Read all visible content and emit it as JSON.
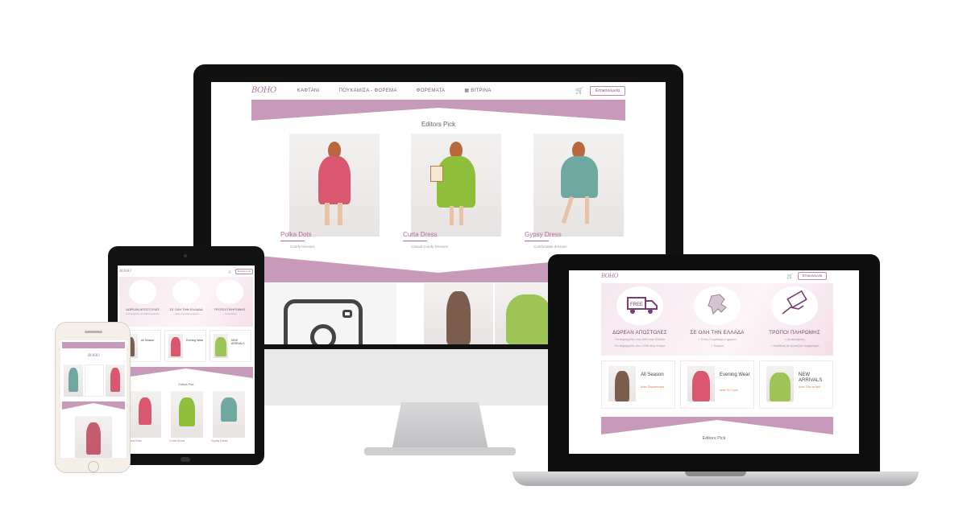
{
  "desktop": {
    "logo": "BOHO",
    "nav": [
      "ΚΑΦΤΑΝΙ",
      "ΠΟΥΚΑΜΙΣΑ - ΦΟΡΕΜΑ",
      "ΦΟΡΕΜΑΤΑ",
      "ΒΙΤΡΙΝΑ"
    ],
    "login_button": "Επικοινωνία",
    "section_title": "Editors Pick",
    "products": [
      {
        "name": "Polka Dots",
        "desc": "Comfy Dresses"
      },
      {
        "name": "Curta Dress",
        "desc": "Casual Comfy Dresses"
      },
      {
        "name": "Gypsy Dress",
        "desc": "Comfortable dresses"
      }
    ]
  },
  "laptop": {
    "logo": "BOHO",
    "login_button": "Επικοινωνία",
    "features": [
      {
        "title": "ΔΩΡΕΑΝ ΑΠΟΣΤΟΛΕΣ",
        "sub1": "Για παραγγελίες άνω 50€ στην Ελλάδα",
        "sub2": "Για παραγγελίες άνω 100€ στην Κύπρο"
      },
      {
        "title": "ΣΕ ΟΛΗ ΤΗΝ ΕΛΛΑΔΑ",
        "sub1": "✓ Εντός 3 εργάσιμων ημερών",
        "sub2": "✓ Κύπρος"
      },
      {
        "title": "ΤΡΟΠΟΙ ΠΛΗΡΩΜΗΣ",
        "sub1": "✓ Αντικαταβολή",
        "sub2": "✓ Κατάθεση σε τραπεζικό λογαριασμό"
      }
    ],
    "categories": [
      {
        "title": "All Season",
        "link": "Δείτε Περισσότερα"
      },
      {
        "title": "Evening Wear",
        "link": "Δείτε Τα Τώρα"
      },
      {
        "title": "NEW ARRIVALS",
        "link": "Δείτε Όλα τα Νέα"
      }
    ],
    "section_title": "Editors Pick"
  },
  "tablet": {
    "logo": "BOHO",
    "login_button": "Επικοινωνία",
    "features": [
      {
        "title": "ΔΩΡΕΑΝ ΑΠΟΣΤΟΛΕΣ",
        "sub": "Για παραγγελίες άνω 50€ στην Ελλάδα"
      },
      {
        "title": "ΣΕ ΟΛΗ ΤΗΝ ΕΛΛΑΔΑ",
        "sub": "✓ Εντός 3 εργάσιμων ημερών"
      },
      {
        "title": "ΤΡΟΠΟΙ ΠΛΗΡΩΜΗΣ",
        "sub": "✓ Αντικαταβολή"
      }
    ],
    "categories": [
      "All Season",
      "Evening Wear",
      "NEW ARRIVALS"
    ],
    "section_title": "Editors Pick",
    "products": [
      "Polka Dots",
      "Curta Dress",
      "Gypsy Dress"
    ]
  },
  "phone": {
    "logo": "BOHO"
  },
  "colors": {
    "accent": "#c79ab9",
    "accent_dark": "#b46aa0",
    "link": "#e0794b"
  }
}
